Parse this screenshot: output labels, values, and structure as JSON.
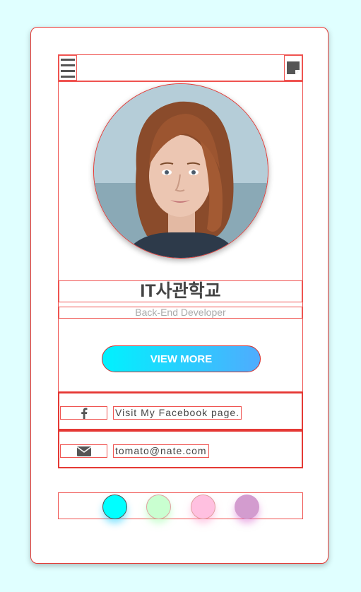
{
  "profile": {
    "name": "IT사관학교",
    "role": "Back-End Developer",
    "cta_label": "VIEW MORE",
    "avatar_icon": "person-portrait"
  },
  "contacts": [
    {
      "icon": "facebook-icon",
      "text": "Visit My Facebook page."
    },
    {
      "icon": "envelope-icon",
      "text": "tomato@nate.com"
    }
  ],
  "themes": {
    "colors": [
      "#00ffff",
      "#c9ffd0",
      "#ffc0e0",
      "#d39ccf"
    ]
  },
  "icons": {
    "menu": "hamburger-menu-icon",
    "note": "sticky-note-icon"
  }
}
